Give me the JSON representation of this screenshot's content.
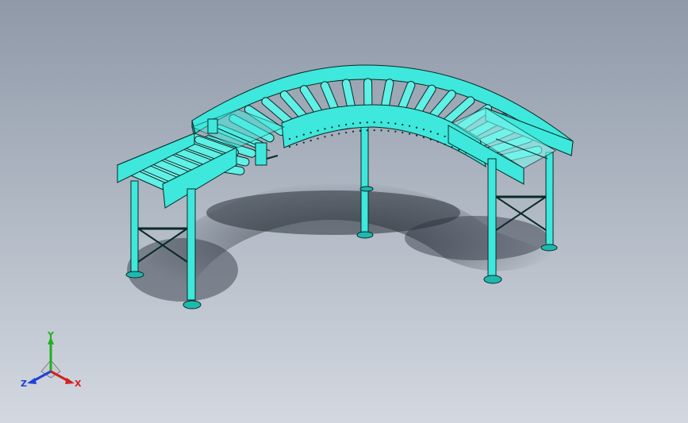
{
  "colors": {
    "background_top": "#8f99a8",
    "background_bottom": "#d3d8e0",
    "part": "#3ee8dc",
    "part_dark": "#1fb8ae",
    "part_light": "#7ff5ee",
    "edge": "#0a2a28",
    "shadow": "#2a313b",
    "axis_x": "#d42020",
    "axis_y": "#20b020",
    "axis_z": "#2040d8"
  },
  "model": {
    "name": "curved-roller-conveyor",
    "display_mode": "shaded-with-edges"
  },
  "triad": {
    "x_label": "X",
    "y_label": "Y",
    "z_label": "Z"
  }
}
